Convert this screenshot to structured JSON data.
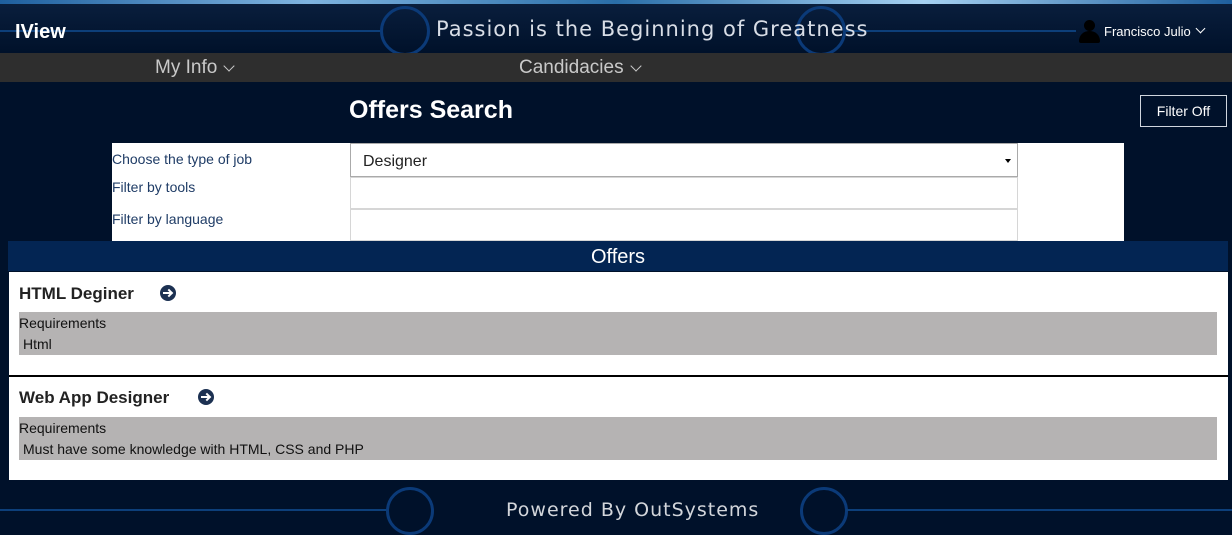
{
  "app": {
    "title": "IView",
    "slogan": "Passion is the Beginning of Greatness",
    "user_name": "Francisco Julio"
  },
  "nav": {
    "items": [
      {
        "label": "My Info"
      },
      {
        "label": "Candidacies"
      }
    ]
  },
  "page": {
    "title": "Offers Search",
    "filter_button": "Filter Off"
  },
  "filters": {
    "job_type_label": "Choose the type of job",
    "job_type_value": "Designer",
    "tools_label": "Filter by tools",
    "tools_value": "",
    "language_label": "Filter by language",
    "language_value": ""
  },
  "offers": {
    "header": "Offers",
    "items": [
      {
        "title": "HTML Deginer",
        "requirements_label": "Requirements",
        "requirements": "Html"
      },
      {
        "title": "Web App Designer",
        "requirements_label": "Requirements",
        "requirements": "Must have some knowledge with HTML, CSS and PHP"
      }
    ]
  },
  "footer": {
    "text": "Powered By OutSystems"
  },
  "colors": {
    "background": "#00112a",
    "nav_bar": "#2e2e2e",
    "offers_header": "#032553",
    "requirements_bg": "#b5b3b3",
    "label_text": "#1f3c66"
  },
  "icons": {
    "user": "user-icon",
    "dropdown": "chevron-down-icon",
    "offer_link": "arrow-circle-right-icon"
  }
}
